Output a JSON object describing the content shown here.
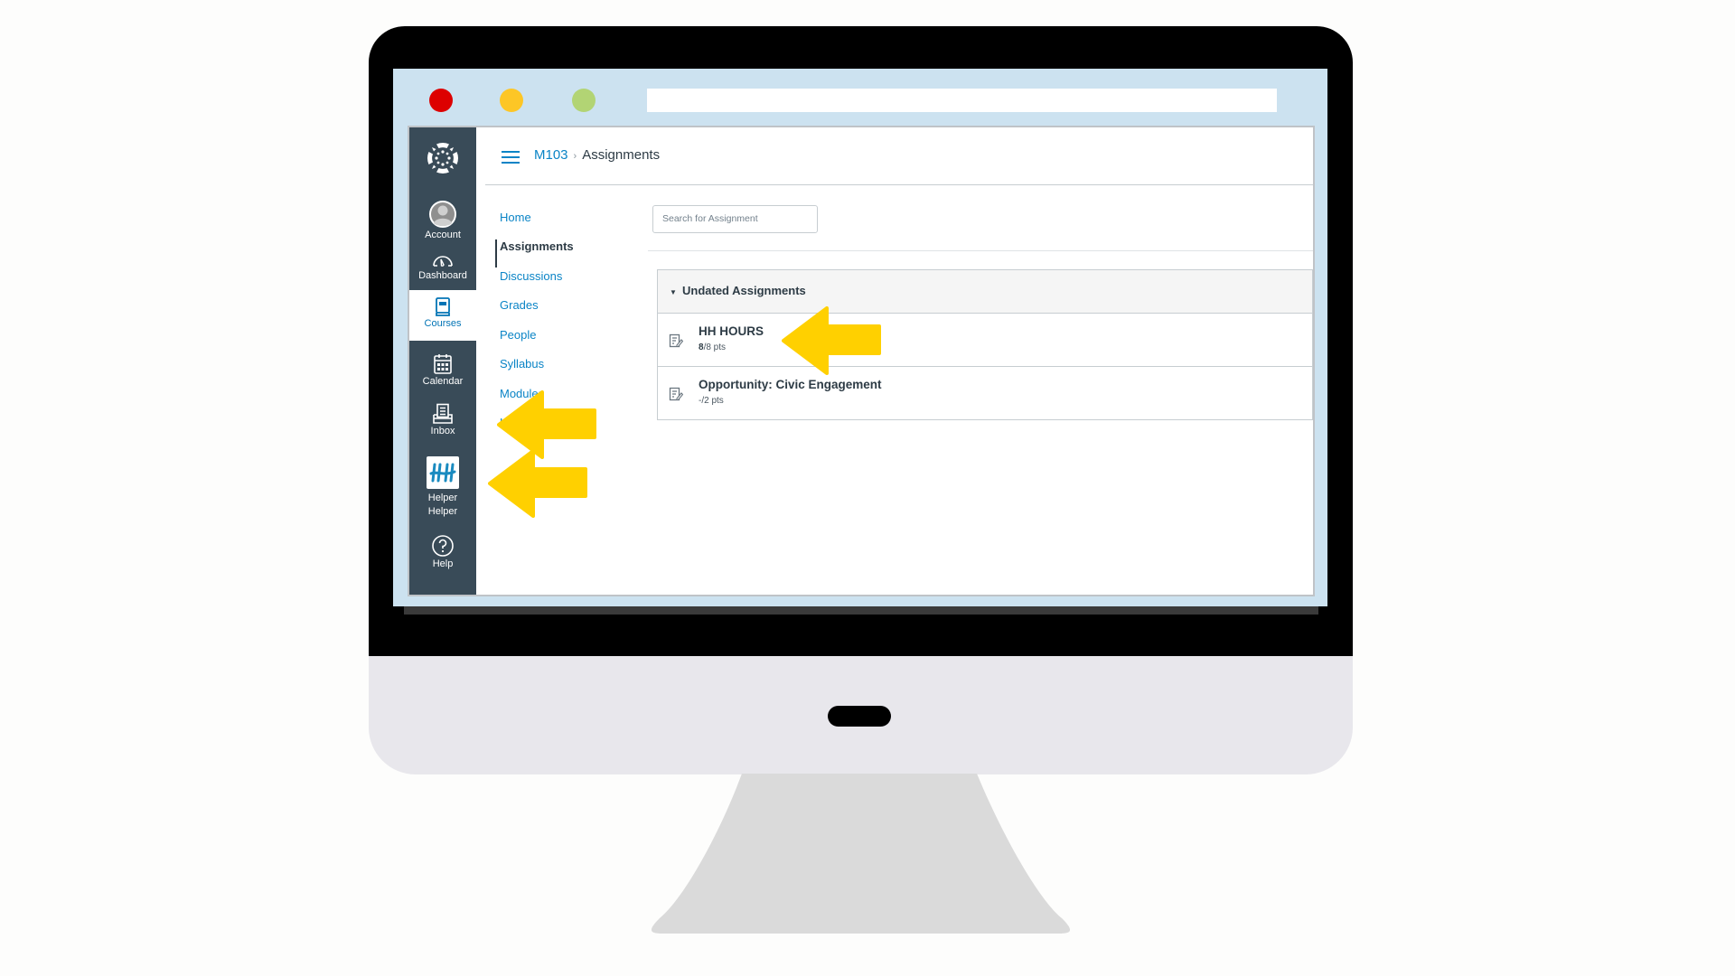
{
  "window": {
    "traffic_lights": [
      {
        "name": "close",
        "color": "#dd0000"
      },
      {
        "name": "minimize",
        "color": "#fdc626"
      },
      {
        "name": "maximize",
        "color": "#b2d474"
      }
    ],
    "address_bar": ""
  },
  "global_nav": {
    "logo": "canvas-logo-icon",
    "items": [
      {
        "label": "Account",
        "icon": "account-avatar-icon",
        "active": false
      },
      {
        "label": "Dashboard",
        "icon": "dashboard-gauge-icon",
        "active": false
      },
      {
        "label": "Courses",
        "icon": "courses-book-icon",
        "active": true
      },
      {
        "label": "Calendar",
        "icon": "calendar-icon",
        "active": false
      },
      {
        "label": "Inbox",
        "icon": "inbox-icon",
        "active": false
      },
      {
        "label_line1": "Helper",
        "label_line2": "Helper",
        "icon": "helper-helper-app-icon",
        "active": false
      },
      {
        "label": "Help",
        "icon": "help-question-icon",
        "active": false
      }
    ]
  },
  "header": {
    "course": "M103",
    "separator": "›",
    "page": "Assignments"
  },
  "course_nav": {
    "items": [
      {
        "label": "Home",
        "active": false
      },
      {
        "label": "Assignments",
        "active": true
      },
      {
        "label": "Discussions",
        "active": false
      },
      {
        "label": "Grades",
        "active": false
      },
      {
        "label": "People",
        "active": false
      },
      {
        "label": "Syllabus",
        "active": false
      },
      {
        "label": "Modules",
        "active": false
      },
      {
        "label": "Helper Helper",
        "active": false
      }
    ]
  },
  "search": {
    "placeholder": "Search for Assignment",
    "value": ""
  },
  "assignment_group": {
    "caret": "▼",
    "title": "Undated Assignments",
    "assignments": [
      {
        "title": "HH HOURS",
        "score": "8",
        "points": "/8 pts"
      },
      {
        "title": "Opportunity: Civic Engagement",
        "score": "-",
        "points": "/2 pts"
      }
    ]
  },
  "annotations": {
    "arrow_color": "#ffd000",
    "targets": [
      "HH HOURS",
      "Helper Helper (course nav)",
      "Helper Helper (global nav)"
    ]
  }
}
